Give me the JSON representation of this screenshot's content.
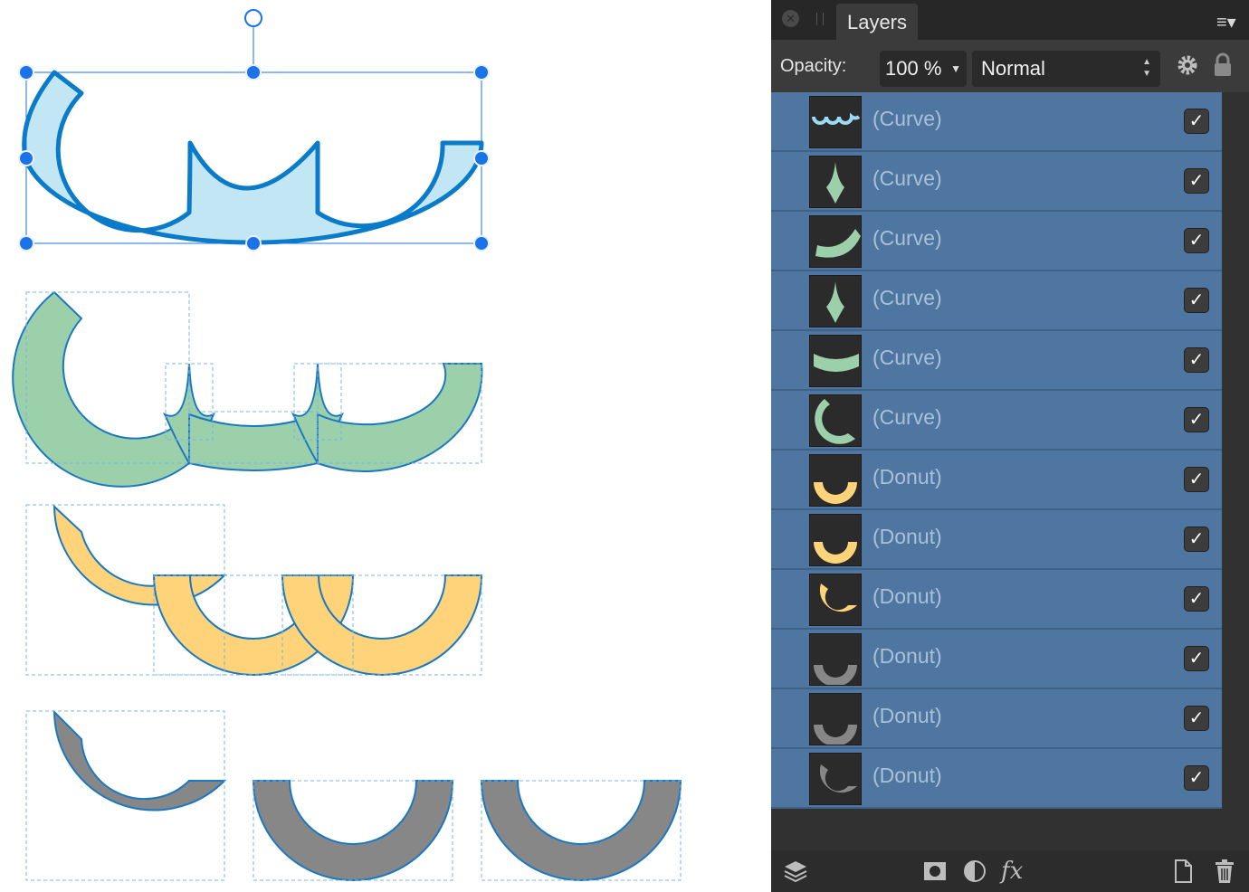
{
  "panel": {
    "tab_label": "Layers",
    "opacity_label": "Opacity:",
    "opacity_value": "100 %",
    "blend_mode": "Normal"
  },
  "layers": [
    {
      "label": "(Curve)",
      "thumb": "waves",
      "visible": true
    },
    {
      "label": "(Curve)",
      "thumb": "spike",
      "visible": true
    },
    {
      "label": "(Curve)",
      "thumb": "arc-right",
      "visible": true
    },
    {
      "label": "(Curve)",
      "thumb": "spike",
      "visible": true
    },
    {
      "label": "(Curve)",
      "thumb": "arc-bottom",
      "visible": true
    },
    {
      "label": "(Curve)",
      "thumb": "c-shape",
      "visible": true
    },
    {
      "label": "(Donut)",
      "thumb": "donut-yellow",
      "visible": true
    },
    {
      "label": "(Donut)",
      "thumb": "donut-yellow",
      "visible": true
    },
    {
      "label": "(Donut)",
      "thumb": "donut-yellow-c",
      "visible": true
    },
    {
      "label": "(Donut)",
      "thumb": "donut-gray",
      "visible": true
    },
    {
      "label": "(Donut)",
      "thumb": "donut-gray",
      "visible": true
    },
    {
      "label": "(Donut)",
      "thumb": "donut-gray-c",
      "visible": true
    }
  ],
  "colors": {
    "selection": "#1a73e8",
    "blue_fill": "#c3e6f4",
    "blue_stroke": "#0a7bc8",
    "green_fill": "#9bd0ab",
    "yellow_fill": "#fed37a",
    "gray_fill": "#878787",
    "row_bg": "#4e76a0",
    "panel_bg": "#313131"
  },
  "icons": [
    "close-icon",
    "menu-icon",
    "gear-icon",
    "lock-icon",
    "layers-icon",
    "mask-icon",
    "adjustment-icon",
    "fx-icon",
    "new-document-icon",
    "trash-icon"
  ]
}
